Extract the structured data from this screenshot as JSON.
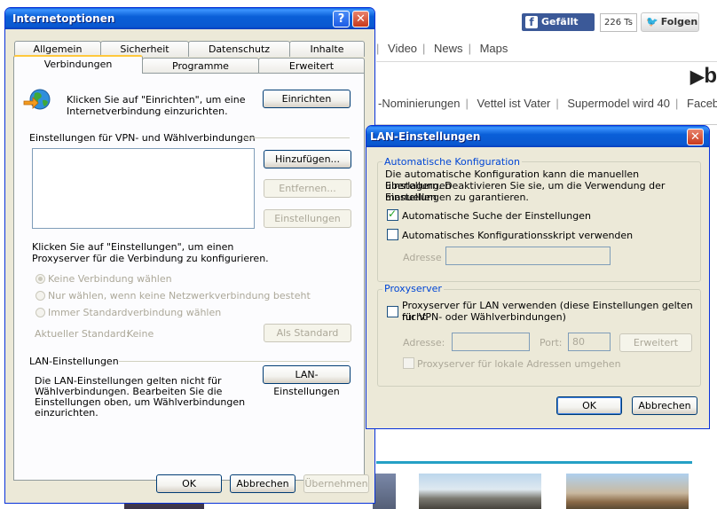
{
  "background": {
    "facebook_like": "Gefällt mir",
    "facebook_count": "226 Ts",
    "twitter_follow": "Folgen",
    "nav_links": [
      "Video",
      "News",
      "Maps"
    ],
    "bing_letter": "b",
    "trends": [
      "-Nominierungen",
      "Vettel ist Vater",
      "Supermodel wird 40",
      "Faceboo"
    ]
  },
  "main_dialog": {
    "title": "Internetoptionen",
    "help_glyph": "?",
    "close_glyph": "✕",
    "tabs_row1": [
      "Allgemein",
      "Sicherheit",
      "Datenschutz",
      "Inhalte"
    ],
    "tabs_row2": [
      "Verbindungen",
      "Programme",
      "Erweitert"
    ],
    "active_tab": "Verbindungen",
    "setup_text_1": "Klicken Sie auf \"Einrichten\", um eine",
    "setup_text_2": "Internetverbindung einzurichten.",
    "setup_button": "Einrichten",
    "vpn_section": "Einstellungen für VPN- und Wählverbindungen",
    "add_button": "Hinzufügen...",
    "remove_button": "Entfernen...",
    "settings_button": "Einstellungen",
    "proxy_text_1": "Klicken Sie auf \"Einstellungen\", um einen",
    "proxy_text_2": "Proxyserver für die Verbindung zu konfigurieren.",
    "radio_options": [
      "Keine Verbindung wählen",
      "Nur wählen, wenn keine Netzwerkverbindung besteht",
      "Immer Standardverbindung wählen"
    ],
    "current_default_label": "Aktueller Standard:",
    "current_default_value": "Keine",
    "as_default_button": "Als Standard",
    "lan_section": "LAN-Einstellungen",
    "lan_text": [
      "Die LAN-Einstellungen gelten nicht für",
      "Wählverbindungen. Bearbeiten Sie die",
      "Einstellungen oben, um Wählverbindungen",
      "einzurichten."
    ],
    "lan_button": "LAN-Einstellungen",
    "ok_button": "OK",
    "cancel_button": "Abbrechen",
    "apply_button": "Übernehmen"
  },
  "lan_dialog": {
    "title": "LAN-Einstellungen",
    "close_glyph": "✕",
    "auto_group": "Automatische Konfiguration",
    "auto_desc": [
      "Die automatische Konfiguration kann die manuellen Einstellungen",
      "überlagern. Deaktivieren Sie sie, um die Verwendung der manuellen",
      "Einstellungen zu garantieren."
    ],
    "auto_detect": "Automatische Suche der Einstellungen",
    "auto_script": "Automatisches Konfigurationsskript verwenden",
    "address_label": "Adresse",
    "proxy_group": "Proxyserver",
    "proxy_use_1": "Proxyserver für LAN verwenden (diese Einstellungen gelten nicht",
    "proxy_use_2": "für VPN- oder Wählverbindungen)",
    "proxy_address_label": "Adresse:",
    "port_label": "Port:",
    "port_value": "80",
    "advanced_button": "Erweitert",
    "bypass_local": "Proxyserver für lokale Adressen umgehen",
    "ok_button": "OK",
    "cancel_button": "Abbrechen"
  },
  "colors": {
    "title_blue": "#0a5fd8",
    "close_red": "#c8391c",
    "group_title": "#0046d5",
    "check_green": "#21a121"
  }
}
